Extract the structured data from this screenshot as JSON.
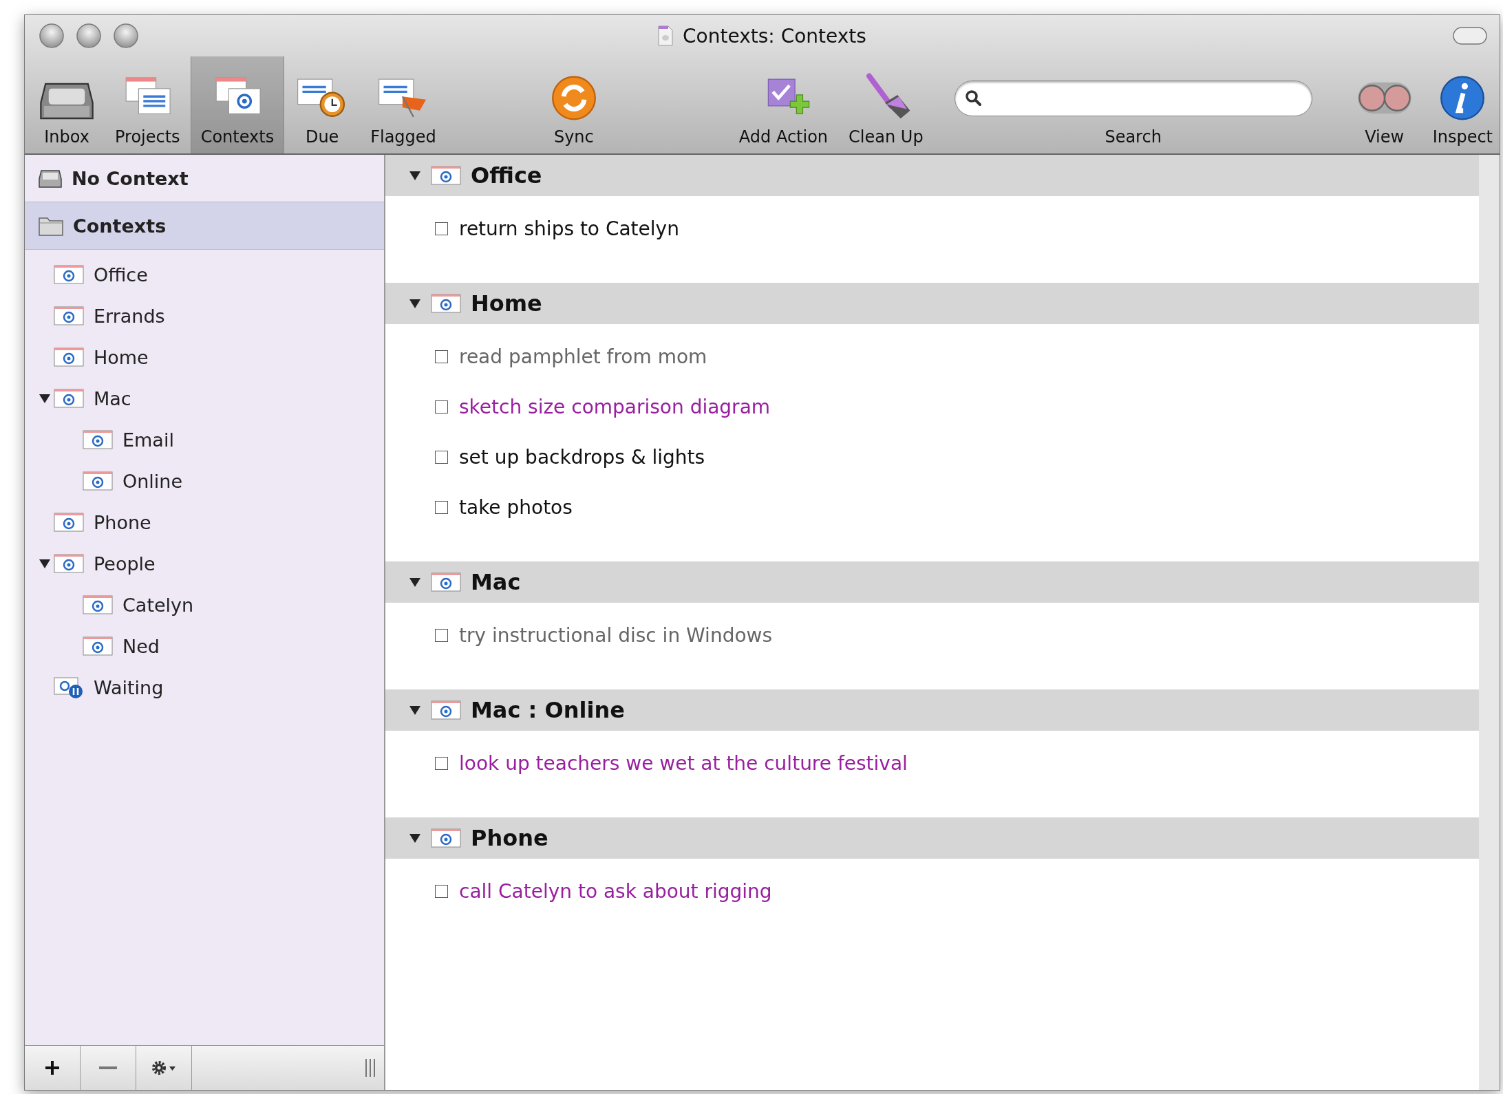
{
  "window": {
    "title": "Contexts: Contexts"
  },
  "toolbar": [
    {
      "label": "Inbox",
      "kind": "button",
      "selected": false
    },
    {
      "label": "Projects",
      "kind": "button",
      "selected": false
    },
    {
      "label": "Contexts",
      "kind": "button",
      "selected": true
    },
    {
      "label": "Due",
      "kind": "button",
      "selected": false
    },
    {
      "label": "Flagged",
      "kind": "button",
      "selected": false
    },
    {
      "label": "Sync",
      "kind": "button",
      "selected": false
    },
    {
      "label": "Add Action",
      "kind": "button",
      "selected": false
    },
    {
      "label": "Clean Up",
      "kind": "button",
      "selected": false
    },
    {
      "label": "Search",
      "kind": "search"
    },
    {
      "label": "View",
      "kind": "button",
      "selected": false
    },
    {
      "label": "Inspect",
      "kind": "button",
      "selected": false
    }
  ],
  "sidebar": {
    "headers": [
      {
        "label": "No Context",
        "kind": "inbox",
        "selected": false
      },
      {
        "label": "Contexts",
        "kind": "folder",
        "selected": true
      }
    ],
    "items": [
      {
        "label": "Office",
        "kind": "context"
      },
      {
        "label": "Errands",
        "kind": "context"
      },
      {
        "label": "Home",
        "kind": "context"
      },
      {
        "label": "Mac",
        "kind": "context",
        "expanded": true,
        "children": [
          {
            "label": "Email",
            "kind": "context"
          },
          {
            "label": "Online",
            "kind": "context"
          }
        ]
      },
      {
        "label": "Phone",
        "kind": "context"
      },
      {
        "label": "People",
        "kind": "context",
        "expanded": true,
        "children": [
          {
            "label": "Catelyn",
            "kind": "context"
          },
          {
            "label": "Ned",
            "kind": "context"
          }
        ]
      },
      {
        "label": "Waiting",
        "kind": "waiting"
      }
    ]
  },
  "groups": [
    {
      "title": "Office",
      "expanded": true,
      "actions": [
        {
          "text": "return ships to Catelyn",
          "checked": false,
          "color": "#111111"
        }
      ]
    },
    {
      "title": "Home",
      "expanded": true,
      "actions": [
        {
          "text": "read pamphlet from mom",
          "checked": false,
          "color": "#666666"
        },
        {
          "text": "sketch size comparison diagram",
          "checked": false,
          "color": "#9a1fa0"
        },
        {
          "text": "set up backdrops & lights",
          "checked": false,
          "color": "#111111"
        },
        {
          "text": "take photos",
          "checked": false,
          "color": "#111111"
        }
      ]
    },
    {
      "title": "Mac",
      "expanded": true,
      "actions": [
        {
          "text": "try instructional disc in Windows",
          "checked": false,
          "color": "#666666"
        }
      ]
    },
    {
      "title": "Mac : Online",
      "expanded": true,
      "actions": [
        {
          "text": "look up teachers we wet at the culture festival",
          "checked": false,
          "color": "#9a1fa0"
        }
      ]
    },
    {
      "title": "Phone",
      "expanded": true,
      "actions": [
        {
          "text": "call Catelyn to ask about rigging",
          "checked": false,
          "color": "#9a1fa0"
        }
      ]
    }
  ]
}
